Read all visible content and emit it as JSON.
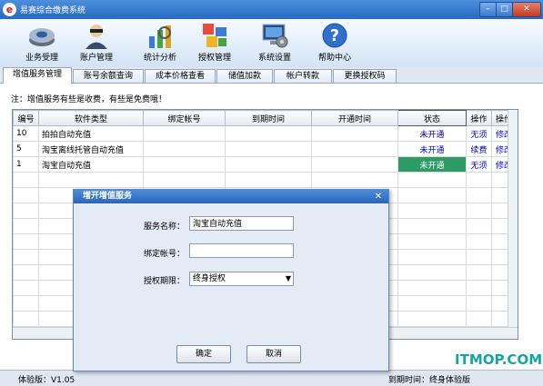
{
  "window": {
    "title": "易赛综合缴费系统",
    "logo_letter": "e"
  },
  "toolbar": [
    {
      "label": "业务受理",
      "icon": "disc-icon"
    },
    {
      "label": "账户管理",
      "icon": "user-icon"
    },
    {
      "label": "统计分析",
      "icon": "chart-icon"
    },
    {
      "label": "授权管理",
      "icon": "blocks-icon"
    },
    {
      "label": "系统设置",
      "icon": "monitor-gear-icon"
    },
    {
      "label": "帮助中心",
      "icon": "help-icon"
    }
  ],
  "tabs": [
    "增值服务管理",
    "账号余额查询",
    "成本价格查看",
    "储值加款",
    "帐户转款",
    "更换授权码"
  ],
  "note": "注：增值服务有些是收费，有些是免费哦！",
  "table": {
    "headers": [
      "编号",
      "软件类型",
      "绑定帐号",
      "到期时间",
      "开通时间",
      "状态",
      "操作",
      "操作"
    ],
    "rows": [
      {
        "id": "10",
        "type": "拍拍自动充值",
        "account": "",
        "expire": "",
        "open": "",
        "status": "未开通",
        "op1": "无须",
        "op2": "修改"
      },
      {
        "id": "5",
        "type": "淘宝离线托管自动充值",
        "account": "",
        "expire": "",
        "open": "",
        "status": "未开通",
        "op1": "续费",
        "op2": "修改"
      },
      {
        "id": "1",
        "type": "淘宝自动充值",
        "account": "",
        "expire": "",
        "open": "",
        "status": "未开通",
        "op1": "无须",
        "op2": "修改"
      }
    ]
  },
  "status_bar": {
    "version": "体验版：V1.05",
    "expire": "到期时间：终身体验版"
  },
  "watermark": "ITMOP.COM",
  "dialog": {
    "title": "增开增值服务",
    "service_label": "服务名称：",
    "service_value": "淘宝自动充值",
    "account_label": "绑定帐号：",
    "account_value": "",
    "period_label": "授权期限：",
    "period_value": "终身授权",
    "ok": "确定",
    "cancel": "取消"
  }
}
